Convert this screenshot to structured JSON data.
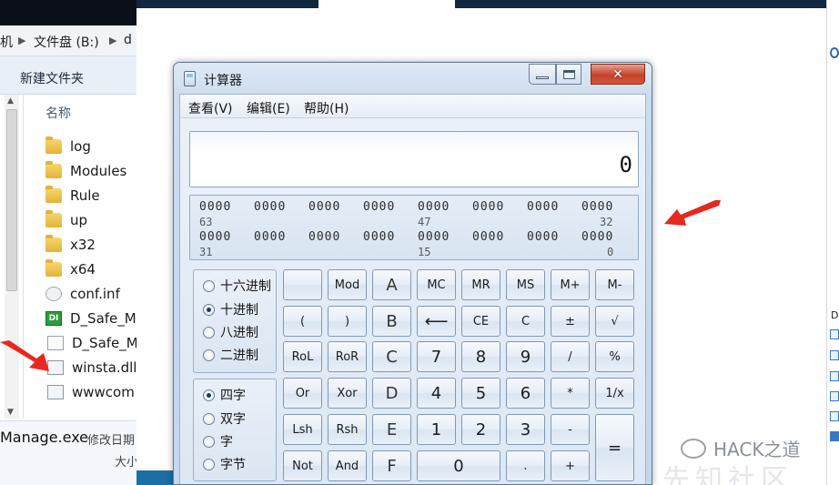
{
  "explorer": {
    "breadcrumb": [
      "机",
      "文件盘 (B:)",
      "d"
    ],
    "toolbar_new_folder": "新建文件夹",
    "column_header": "名称",
    "files": [
      {
        "name": "log",
        "icon": "folder-icon"
      },
      {
        "name": "Modules",
        "icon": "folder-icon"
      },
      {
        "name": "Rule",
        "icon": "folder-icon"
      },
      {
        "name": "up",
        "icon": "folder-icon"
      },
      {
        "name": "x32",
        "icon": "folder-icon"
      },
      {
        "name": "x64",
        "icon": "folder-icon"
      },
      {
        "name": "conf.inf",
        "icon": "settings-file-icon"
      },
      {
        "name": "D_Safe_M",
        "icon": "exe-app-icon"
      },
      {
        "name": "D_Safe_M",
        "icon": "document-icon"
      },
      {
        "name": "winsta.dll",
        "icon": "dll-file-icon"
      },
      {
        "name": "wwwcom",
        "icon": "dll-file-icon"
      }
    ],
    "exe_icon_text": "DI",
    "status_filename": "Manage.exe",
    "status_modified": "修改日期",
    "status_size": "大小"
  },
  "watermark": {
    "text": "HACK之道",
    "faint": "先知社区"
  },
  "calculator": {
    "title": "计算器",
    "menu": [
      "查看(V)",
      "编辑(E)",
      "帮助(H)"
    ],
    "display_value": "0",
    "binary_row1": [
      "0000",
      "0000",
      "0000",
      "0000",
      "0000",
      "0000",
      "0000",
      "0000"
    ],
    "binary_row1_indices": [
      "63",
      "47",
      "32"
    ],
    "binary_row2": [
      "0000",
      "0000",
      "0000",
      "0000",
      "0000",
      "0000",
      "0000",
      "0000"
    ],
    "binary_row2_indices": [
      "31",
      "15",
      "0"
    ],
    "base_options": [
      {
        "label": "十六进制",
        "selected": false
      },
      {
        "label": "十进制",
        "selected": true
      },
      {
        "label": "八进制",
        "selected": false
      },
      {
        "label": "二进制",
        "selected": false
      }
    ],
    "word_options": [
      {
        "label": "四字",
        "selected": true
      },
      {
        "label": "双字",
        "selected": false
      },
      {
        "label": "字",
        "selected": false
      },
      {
        "label": "字节",
        "selected": false
      }
    ],
    "keys": {
      "blank": "",
      "mod": "Mod",
      "a": "A",
      "mc": "MC",
      "mr": "MR",
      "ms": "MS",
      "mplus": "M+",
      "mminus": "M-",
      "lparen": "(",
      "rparen": ")",
      "b": "B",
      "backspace": "⟵",
      "ce": "CE",
      "c": "C",
      "plusminus": "±",
      "sqrt": "√",
      "rol": "RoL",
      "ror": "RoR",
      "c_hex": "C",
      "seven": "7",
      "eight": "8",
      "nine": "9",
      "divide": "/",
      "percent": "%",
      "or": "Or",
      "xor": "Xor",
      "d": "D",
      "four": "4",
      "five": "5",
      "six": "6",
      "multiply": "*",
      "reciprocal": "1/x",
      "lsh": "Lsh",
      "rsh": "Rsh",
      "e": "E",
      "one": "1",
      "two": "2",
      "three": "3",
      "minus": "-",
      "equals": "=",
      "not": "Not",
      "and": "And",
      "f": "F",
      "zero": "0",
      "dot": ".",
      "plus": "+"
    }
  },
  "colors": {
    "arrow": "#e8281e",
    "calc_bg": "#cbdcee",
    "close_button": "#c4422b"
  }
}
